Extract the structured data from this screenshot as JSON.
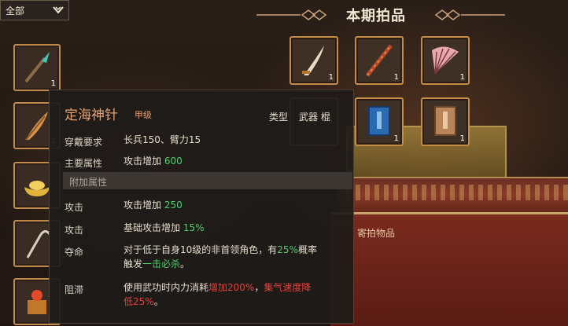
{
  "filter": {
    "label": "全部",
    "icon": "chevron-down-icon"
  },
  "inventory": {
    "items": [
      {
        "icon": "spear-icon",
        "count": "1"
      },
      {
        "icon": "feather-fan-icon",
        "count": "1"
      },
      {
        "icon": "gold-ingot-icon",
        "count": ""
      },
      {
        "icon": "hook-icon",
        "count": ""
      },
      {
        "icon": "treasure-chest-icon",
        "count": ""
      }
    ]
  },
  "auction": {
    "title": "本期拍品",
    "items": [
      {
        "icon": "saber-icon",
        "count": "1"
      },
      {
        "icon": "staff-icon",
        "count": "1"
      },
      {
        "icon": "fan-icon",
        "count": "1"
      },
      {
        "icon": "blue-book-icon",
        "count": "1"
      },
      {
        "icon": "brown-book-icon",
        "count": "1"
      }
    ],
    "consign_label": "寄拍物品"
  },
  "tooltip": {
    "name": "定海神针",
    "grade": "甲级",
    "type_label": "类型",
    "type_value": "武器 棍",
    "requirement_label": "穿戴要求",
    "requirement_value": "长兵150、臂力15",
    "main_attr_label": "主要属性",
    "main_attr_prefix": "攻击增加",
    "main_attr_value": "600",
    "extra_section": "附加属性",
    "extra": [
      {
        "label": "攻击",
        "prefix": "攻击增加",
        "value": "250"
      },
      {
        "label": "攻击",
        "prefix": "基础攻击增加",
        "value": "15%"
      }
    ],
    "effect1": {
      "label": "夺命",
      "line1_prefix": "对于低于自身10级的非首领角色，有",
      "line1_value": "25%",
      "line1_suffix": "概率",
      "line2_prefix": "触发",
      "line2_value": "一击必杀",
      "line2_suffix": "。"
    },
    "effect2": {
      "label": "阻滞",
      "line1_prefix": "使用武功时内力消耗",
      "line1_red1": "增加200%",
      "line1_sep": "，",
      "line1_red2": "集气速度降",
      "line2_red": "低25%",
      "line2_suffix": "。"
    }
  },
  "colors": {
    "item_name": "#e9a06e",
    "positive": "#4ccf6a",
    "negative": "#e2433a",
    "slot_border": "#c48c46"
  }
}
